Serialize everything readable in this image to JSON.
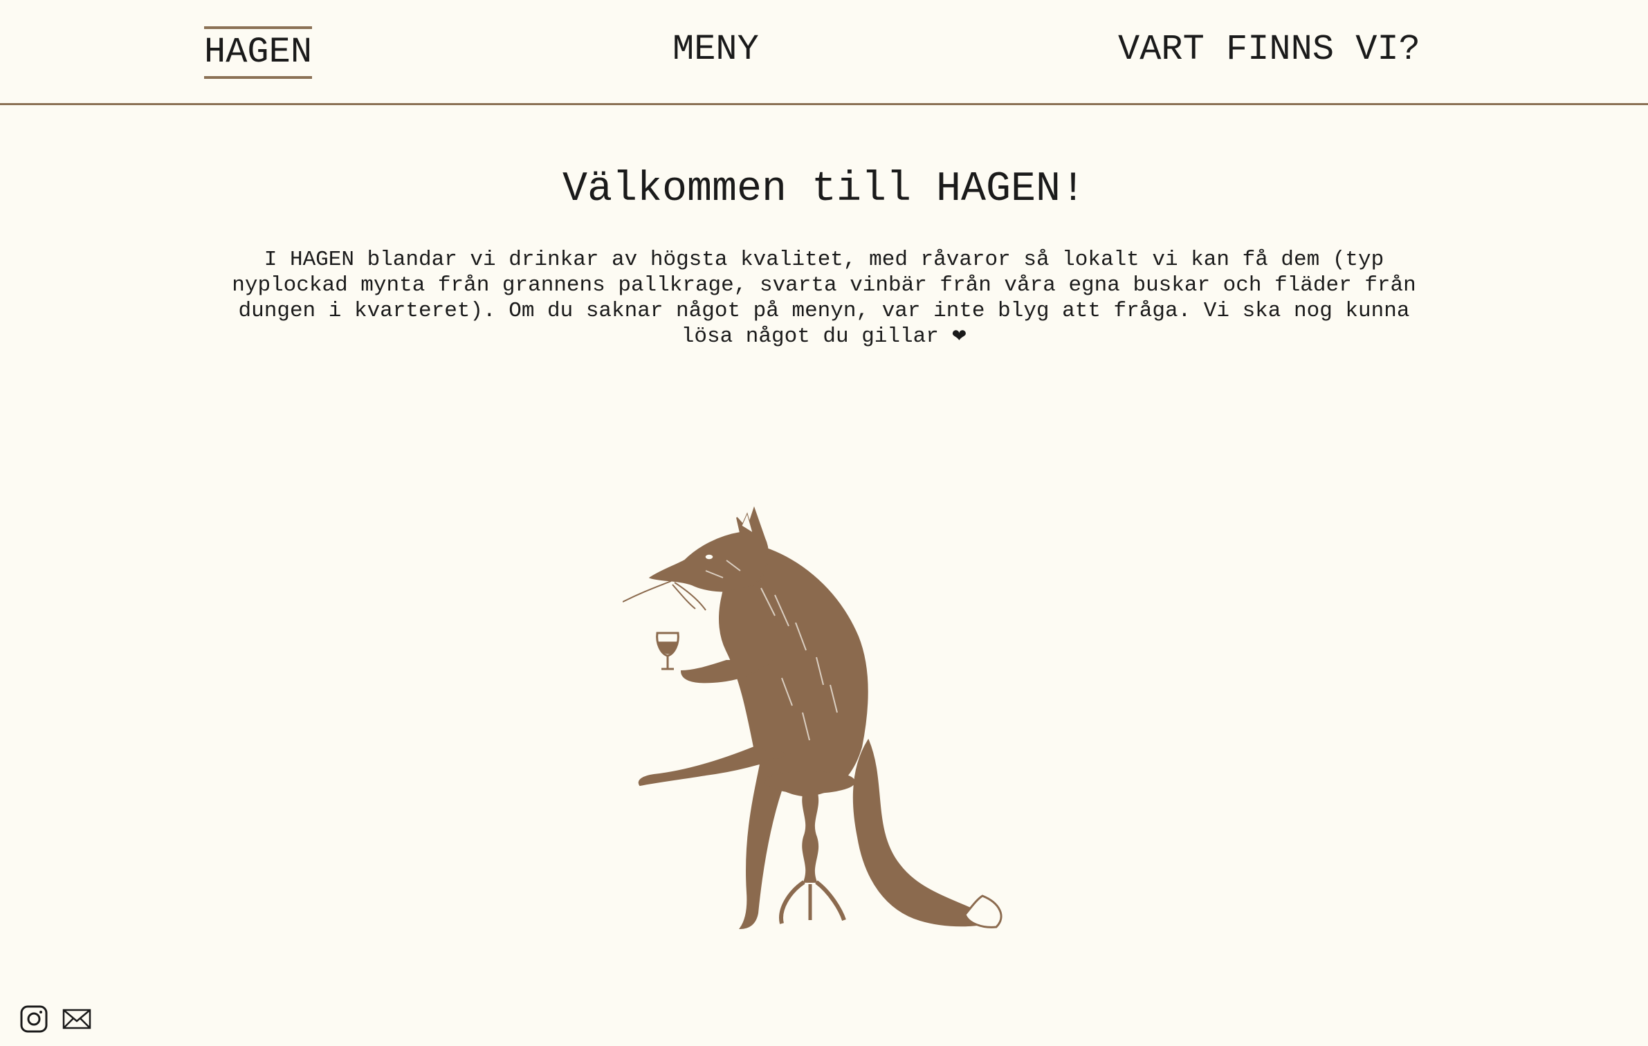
{
  "nav": {
    "items": [
      {
        "label": "HAGEN",
        "active": true
      },
      {
        "label": "MENY",
        "active": false
      },
      {
        "label": "VART FINNS VI?",
        "active": false
      }
    ]
  },
  "main": {
    "title": "Välkommen till HAGEN!",
    "intro": "I HAGEN blandar vi drinkar av högsta kvalitet, med råvaror så lokalt vi kan få dem (typ nyplockad mynta från grannens pallkrage, svarta vinbär från våra egna buskar och fläder från dungen i kvarteret). Om du saknar något på menyn, var inte blyg att fråga. Vi ska nog kunna lösa något du gillar",
    "heart": "❤"
  },
  "illustration": {
    "icon": "fox-with-wine-glass-illustration",
    "color": "#8b6a4e"
  },
  "social": {
    "icons": [
      "instagram-icon",
      "mail-icon"
    ]
  },
  "colors": {
    "background": "#fdfbf3",
    "accent": "#8b7155",
    "text": "#1a1a1a"
  }
}
